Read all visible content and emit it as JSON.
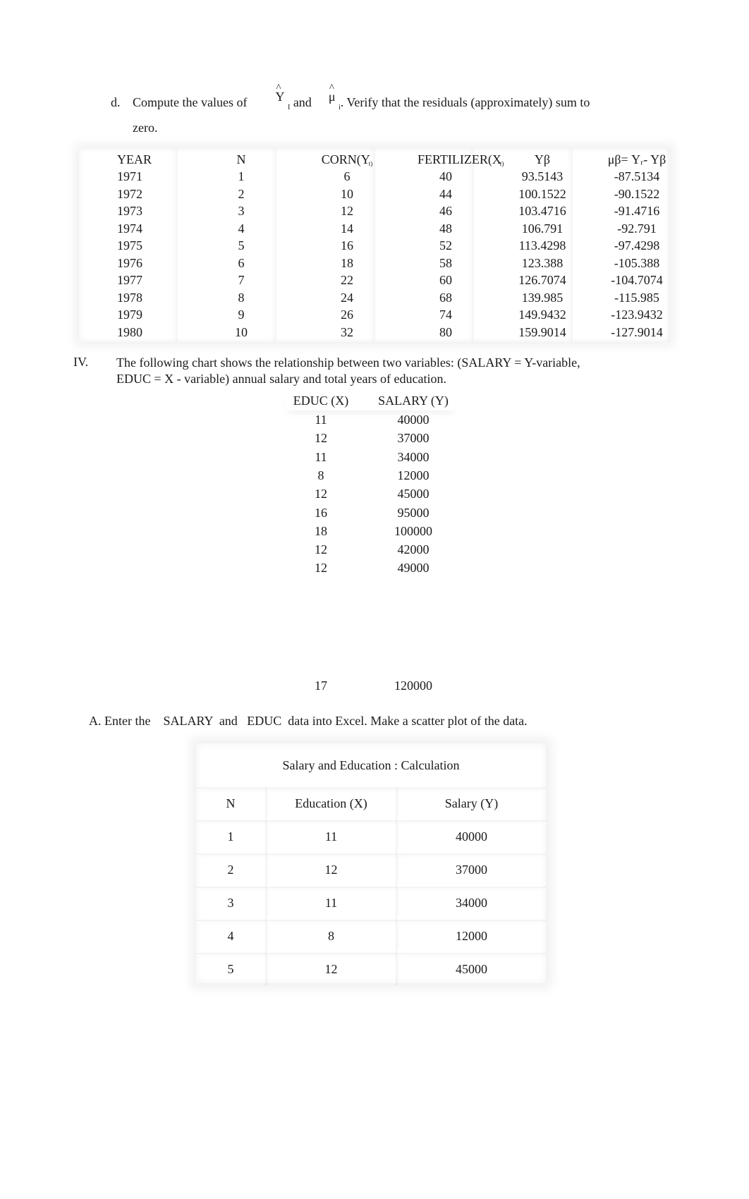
{
  "question_d": {
    "label": "d.",
    "text_before": "Compute the values of",
    "symbol1_base": "Y",
    "symbol1_hat": "^",
    "symbol1_sub": "I",
    "text_and": "and",
    "symbol2_base": "μ",
    "symbol2_hat": "^",
    "symbol2_sub": "i",
    "text_after": ". Verify that the residuals (approximately) sum to",
    "text_continued": "zero."
  },
  "table1": {
    "headers": {
      "year": "YEAR",
      "n": "N",
      "corn": "CORN(Y",
      "corn_sub": "t)",
      "fertilizer": "FERTILIZER(X",
      "fertilizer_sub": "t)",
      "yhat": "Yβ",
      "residual": "μβ= Yᵣ- Yβ"
    },
    "rows": [
      {
        "year": "1971",
        "n": "1",
        "corn": "6",
        "fertilizer": "40",
        "yhat": "93.5143",
        "residual": "-87.5134"
      },
      {
        "year": "1972",
        "n": "2",
        "corn": "10",
        "fertilizer": "44",
        "yhat": "100.1522",
        "residual": "-90.1522"
      },
      {
        "year": "1973",
        "n": "3",
        "corn": "12",
        "fertilizer": "46",
        "yhat": "103.4716",
        "residual": "-91.4716"
      },
      {
        "year": "1974",
        "n": "4",
        "corn": "14",
        "fertilizer": "48",
        "yhat": "106.791",
        "residual": "-92.791"
      },
      {
        "year": "1975",
        "n": "5",
        "corn": "16",
        "fertilizer": "52",
        "yhat": "113.4298",
        "residual": "-97.4298"
      },
      {
        "year": "1976",
        "n": "6",
        "corn": "18",
        "fertilizer": "58",
        "yhat": "123.388",
        "residual": "-105.388"
      },
      {
        "year": "1977",
        "n": "7",
        "corn": "22",
        "fertilizer": "60",
        "yhat": "126.7074",
        "residual": "-104.7074"
      },
      {
        "year": "1978",
        "n": "8",
        "corn": "24",
        "fertilizer": "68",
        "yhat": "139.985",
        "residual": "-115.985"
      },
      {
        "year": "1979",
        "n": "9",
        "corn": "26",
        "fertilizer": "74",
        "yhat": "149.9432",
        "residual": "-123.9432"
      },
      {
        "year": "1980",
        "n": "10",
        "corn": "32",
        "fertilizer": "80",
        "yhat": "159.9014",
        "residual": "-127.9014"
      }
    ]
  },
  "section_iv": {
    "label": "IV.",
    "line1": "The following chart shows the relationship between two variables: (SALARY = Y-variable,",
    "line2": "EDUC = X - variable) annual salary and total years of education."
  },
  "educ_salary_list": {
    "header_educ": "EDUC (X)",
    "header_salary": "SALARY (Y)",
    "rows": [
      {
        "educ": "11",
        "salary": "40000"
      },
      {
        "educ": "12",
        "salary": "37000"
      },
      {
        "educ": "11",
        "salary": "34000"
      },
      {
        "educ": "8",
        "salary": "12000"
      },
      {
        "educ": "12",
        "salary": "45000"
      },
      {
        "educ": "16",
        "salary": "95000"
      },
      {
        "educ": "18",
        "salary": "100000"
      },
      {
        "educ": "12",
        "salary": "42000"
      },
      {
        "educ": "12",
        "salary": "49000"
      }
    ],
    "last_row": {
      "educ": "17",
      "salary": "120000"
    }
  },
  "question_a": {
    "text": "A. Enter the    SALARY  and   EDUC  data into Excel. Make a scatter plot of the data."
  },
  "table2": {
    "title": "Salary and Education : Calculation",
    "headers": {
      "n": "N",
      "education": "Education (X)",
      "salary": "Salary (Y)"
    },
    "rows": [
      {
        "n": "1",
        "education": "11",
        "salary": "40000"
      },
      {
        "n": "2",
        "education": "12",
        "salary": "37000"
      },
      {
        "n": "3",
        "education": "11",
        "salary": "34000"
      },
      {
        "n": "4",
        "education": "8",
        "salary": "12000"
      },
      {
        "n": "5",
        "education": "12",
        "salary": "45000"
      }
    ]
  }
}
